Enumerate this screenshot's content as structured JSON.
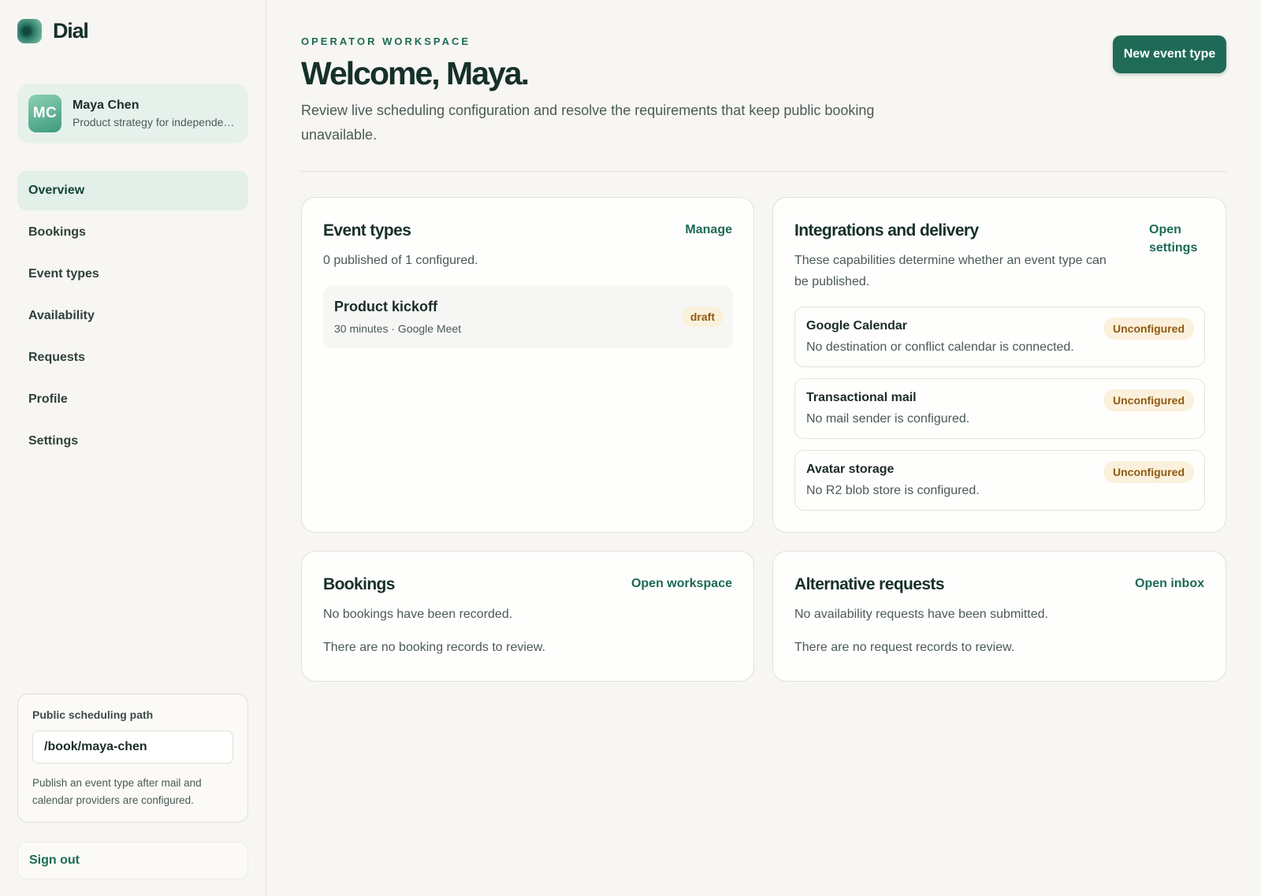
{
  "brand": {
    "name": "Dial"
  },
  "profile": {
    "initials": "MC",
    "name": "Maya Chen",
    "subtitle": "Product strategy for independent teams"
  },
  "nav": {
    "items": [
      {
        "label": "Overview"
      },
      {
        "label": "Bookings"
      },
      {
        "label": "Event types"
      },
      {
        "label": "Availability"
      },
      {
        "label": "Requests"
      },
      {
        "label": "Profile"
      },
      {
        "label": "Settings"
      }
    ],
    "active": "Overview"
  },
  "public_path": {
    "label": "Public scheduling path",
    "value": "/book/maya-chen",
    "help": "Publish an event type after mail and calendar providers are configured."
  },
  "sign_out_label": "Sign out",
  "header": {
    "eyebrow": "OPERATOR WORKSPACE",
    "title": "Welcome, Maya.",
    "intro": "Review live scheduling configuration and resolve the requirements that keep public booking unavailable.",
    "primary_action": "New event type"
  },
  "event_types": {
    "title": "Event types",
    "link": "Manage",
    "summary": "0 published of 1 configured.",
    "items": [
      {
        "name": "Product kickoff",
        "meta": "30 minutes · Google Meet",
        "status": "draft"
      }
    ]
  },
  "integrations": {
    "title": "Integrations and delivery",
    "link": "Open settings",
    "summary": "These capabilities determine whether an event type can be published.",
    "items": [
      {
        "name": "Google Calendar",
        "description": "No destination or conflict calendar is connected.",
        "status": "Unconfigured"
      },
      {
        "name": "Transactional mail",
        "description": "No mail sender is configured.",
        "status": "Unconfigured"
      },
      {
        "name": "Avatar storage",
        "description": "No R2 blob store is configured.",
        "status": "Unconfigured"
      }
    ]
  },
  "bookings": {
    "title": "Bookings",
    "link": "Open workspace",
    "summary": "No bookings have been recorded.",
    "empty": "There are no booking records to review."
  },
  "requests": {
    "title": "Alternative requests",
    "link": "Open inbox",
    "summary": "No availability requests have been submitted.",
    "empty": "There are no request records to review."
  },
  "colors": {
    "accent": "#1f6b57",
    "warning_bg": "#fbf0dc",
    "warning_text": "#8f5a12",
    "background": "#f7f6f2"
  }
}
